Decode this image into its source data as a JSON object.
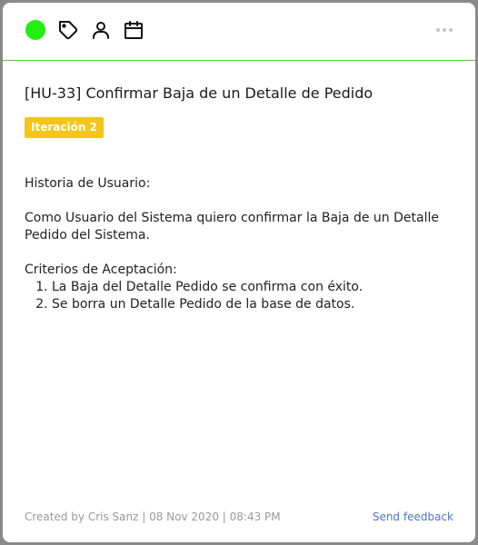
{
  "toolbar": {
    "status_color": "#22ee11",
    "accent_color": "#4fce3c",
    "icons": [
      "tag-icon",
      "user-icon",
      "calendar-icon"
    ],
    "more_icon": "more-horizontal-icon"
  },
  "card": {
    "title": "[HU-33] Confirmar Baja de un Detalle de Pedido",
    "badge": "Iteración 2",
    "badge_color": "#f5c518",
    "description": {
      "heading": "Historia de Usuario:",
      "story_line1": "Como Usuario del Sistema quiero confirmar la Baja de un Detalle",
      "story_line2": "Pedido del Sistema.",
      "criteria_heading": "Criterios de Aceptación:",
      "criteria": [
        "La Baja del Detalle Pedido se confirma con éxito.",
        "Se borra un Detalle Pedido de la base de datos."
      ]
    }
  },
  "footer": {
    "meta": "Created by Cris Sanz | 08 Nov 2020 | 08:43 PM",
    "feedback": "Send feedback"
  }
}
